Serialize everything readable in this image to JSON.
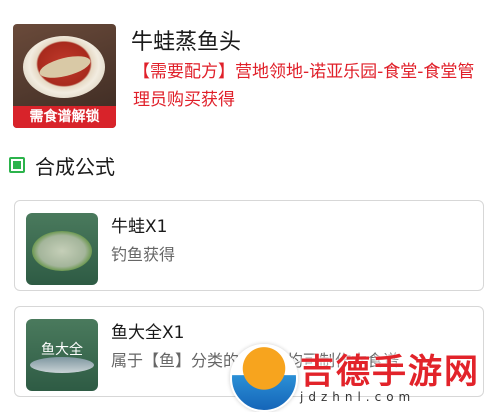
{
  "dish": {
    "title": "牛蛙蒸鱼头",
    "lock_label": "需食谱解锁",
    "recipe_text": "【需要配方】营地领地-诺亚乐园-食堂-食堂管理员购买获得"
  },
  "section": {
    "title": "合成公式"
  },
  "ingredients": [
    {
      "name": "牛蛙X1",
      "desc": "钓鱼获得",
      "image_label": ""
    },
    {
      "name": "鱼大全X1",
      "desc": "属于【鱼】分类的材料，均可制作本食谱",
      "image_label": "鱼大全"
    }
  ],
  "watermark": {
    "text": "吉德手游网",
    "sub": "jdzhnl.com"
  },
  "colors": {
    "accent_red": "#e0202a",
    "section_green": "#2bb34b"
  }
}
